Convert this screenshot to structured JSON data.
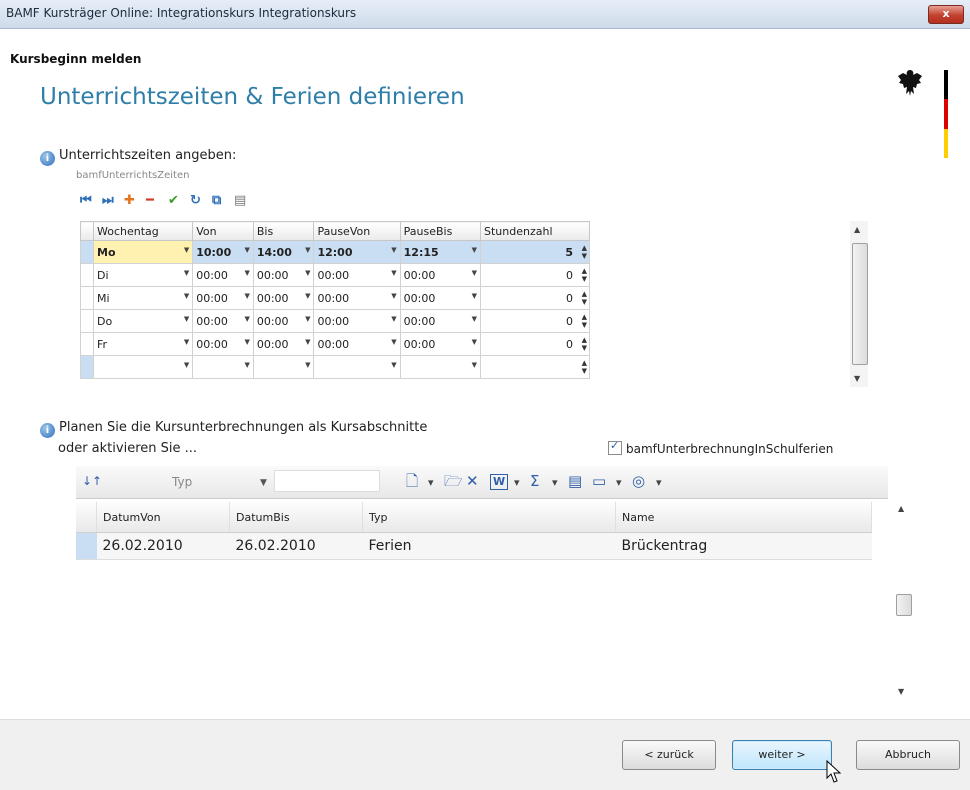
{
  "window": {
    "title": "BAMF Kursträger Online: Integrationskurs Integrationskurs",
    "close_label": "x"
  },
  "header": {
    "subtitle": "Kursbeginn melden",
    "title": "Unterrichtszeiten & Ferien definieren",
    "flag_colors": [
      "#000000",
      "#dd0000",
      "#ffce00"
    ]
  },
  "section1": {
    "heading": "Unterrichtszeiten angeben:",
    "control_label": "bamfUnterrichtsZeiten",
    "toolbar": [
      {
        "name": "first-record-icon",
        "glyph": "⏮",
        "color": "#2f6fb8"
      },
      {
        "name": "last-record-icon",
        "glyph": "⏭",
        "color": "#2f6fb8"
      },
      {
        "name": "add-record-icon",
        "glyph": "✚",
        "color": "#e2731a"
      },
      {
        "name": "delete-record-icon",
        "glyph": "━",
        "color": "#d23a2a"
      },
      {
        "name": "confirm-icon",
        "glyph": "✔",
        "color": "#3a9a2a"
      },
      {
        "name": "refresh-icon",
        "glyph": "↻",
        "color": "#2f6fb8"
      },
      {
        "name": "copy-icon",
        "glyph": "⧉",
        "color": "#2f6fb8"
      },
      {
        "name": "paste-icon",
        "glyph": "▤",
        "color": "#777777"
      }
    ],
    "columns": [
      "Wochentag",
      "Von",
      "Bis",
      "PauseVon",
      "PauseBis",
      "Stundenzahl"
    ],
    "rows": [
      {
        "tag": "Mo",
        "von": "10:00",
        "bis": "14:00",
        "pv": "12:00",
        "pb": "12:15",
        "std": "5"
      },
      {
        "tag": "Di",
        "von": "00:00",
        "bis": "00:00",
        "pv": "00:00",
        "pb": "00:00",
        "std": "0"
      },
      {
        "tag": "Mi",
        "von": "00:00",
        "bis": "00:00",
        "pv": "00:00",
        "pb": "00:00",
        "std": "0"
      },
      {
        "tag": "Do",
        "von": "00:00",
        "bis": "00:00",
        "pv": "00:00",
        "pb": "00:00",
        "std": "0"
      },
      {
        "tag": "Fr",
        "von": "00:00",
        "bis": "00:00",
        "pv": "00:00",
        "pb": "00:00",
        "std": "0"
      },
      {
        "tag": "",
        "von": "",
        "bis": "",
        "pv": "",
        "pb": "",
        "std": ""
      }
    ]
  },
  "section2": {
    "heading_line1": "Planen Sie die Kursunterbrechnungen als Kursabschnitte",
    "heading_line2": "oder aktivieren Sie ...",
    "checkbox_label": "bamfUnterbrechnungInSchulferien",
    "filter_label": "Typ",
    "toolbar": [
      {
        "name": "new-document-icon",
        "glyph": "🗋"
      },
      {
        "name": "dropdown-arrow-icon",
        "glyph": "▾"
      },
      {
        "name": "open-folder-icon",
        "glyph": "🗁"
      },
      {
        "name": "delete-x-icon",
        "glyph": "✕"
      },
      {
        "name": "word-export-icon",
        "glyph": "W"
      },
      {
        "name": "dropdown-arrow-icon",
        "glyph": "▾"
      },
      {
        "name": "sum-icon",
        "glyph": "Σ"
      },
      {
        "name": "dropdown-arrow-icon",
        "glyph": "▾"
      },
      {
        "name": "layout-top-icon",
        "glyph": "▤"
      },
      {
        "name": "layout-window-icon",
        "glyph": "▭"
      },
      {
        "name": "dropdown-arrow-icon",
        "glyph": "▾"
      },
      {
        "name": "settings-icon",
        "glyph": "◎"
      },
      {
        "name": "dropdown-arrow-icon",
        "glyph": "▾"
      }
    ],
    "columns": [
      "DatumVon",
      "DatumBis",
      "Typ",
      "Name"
    ],
    "rows": [
      {
        "von": "26.02.2010",
        "bis": "26.02.2010",
        "typ": "Ferien",
        "name": "Brückentrag"
      }
    ]
  },
  "footer": {
    "back": "< zurück",
    "next": "weiter >",
    "cancel": "Abbruch"
  }
}
